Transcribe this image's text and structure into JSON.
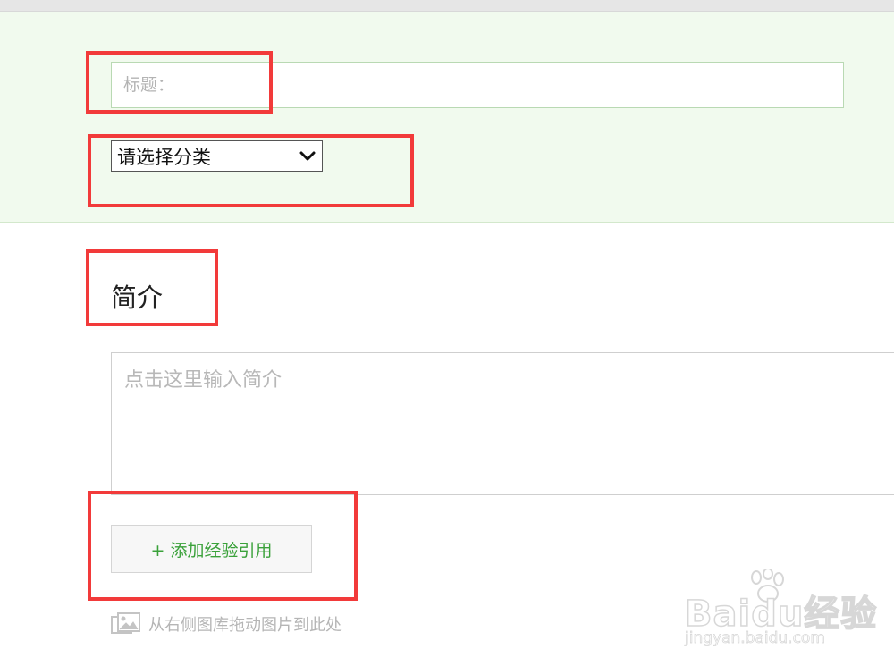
{
  "form": {
    "title_placeholder": "标题：",
    "category_label": "请选择分类",
    "intro_heading": "简介",
    "intro_placeholder": "点击这里输入简介",
    "add_reference_label": "+ 添加经验引用",
    "drop_hint": "从右侧图库拖动图片到此处"
  },
  "icons": {
    "category_chevron": "chevron-down-icon",
    "drop_image": "image-icon"
  },
  "watermark": {
    "brand": "Baidu经验",
    "url": "jingyan.baidu.com"
  },
  "colors": {
    "panel_bg": "#f1faee",
    "highlight": "#f23a3a",
    "accent_green": "#3aa13a"
  }
}
